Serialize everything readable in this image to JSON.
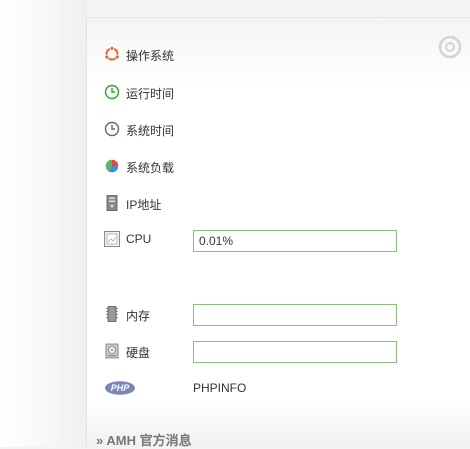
{
  "rows": [
    {
      "key": "os",
      "label": "操作系统",
      "icon": "ubuntu-icon"
    },
    {
      "key": "uptime",
      "label": "运行时间",
      "icon": "clock-green-icon"
    },
    {
      "key": "time",
      "label": "系统时间",
      "icon": "clock-gray-icon"
    },
    {
      "key": "load",
      "label": "系统负载",
      "icon": "pie-chart-icon"
    },
    {
      "key": "ip",
      "label": "IP地址",
      "icon": "server-icon"
    },
    {
      "key": "cpu",
      "label": "CPU",
      "icon": "cpu-icon"
    },
    {
      "key": "mem",
      "label": "内存",
      "icon": "memory-icon"
    },
    {
      "key": "disk",
      "label": "硬盘",
      "icon": "disk-icon"
    },
    {
      "key": "php",
      "label": "PHPINFO",
      "icon": "php-icon"
    }
  ],
  "fields": {
    "cpu_value": "0.01%",
    "mem_value": "",
    "disk_value": ""
  },
  "php_logo_text": "PHP",
  "footer": {
    "title": "» AMH 官方消息"
  },
  "colors": {
    "field_border": "#8bbf7f",
    "footer_text": "#777777"
  }
}
